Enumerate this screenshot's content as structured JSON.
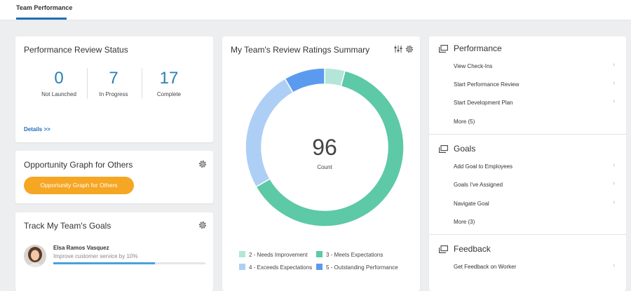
{
  "tab": {
    "label": "Team Performance"
  },
  "review_status": {
    "title": "Performance Review Status",
    "stats": [
      {
        "value": "0",
        "label": "Not Launched"
      },
      {
        "value": "7",
        "label": "In Progress"
      },
      {
        "value": "17",
        "label": "Complete"
      }
    ],
    "details_link": "Details >>"
  },
  "opportunity": {
    "title": "Opportunity Graph for Others",
    "button_label": "Opportunity Graph for Others"
  },
  "goals_card": {
    "title": "Track My Team's Goals",
    "goal": {
      "name": "Elsa Ramos Vasquez",
      "description": "Improve customer service by 10%",
      "progress": 0.67
    }
  },
  "ratings": {
    "title": "My Team's Review Ratings Summary",
    "total": "96",
    "total_label": "Count"
  },
  "chart_data": {
    "type": "pie",
    "subtype": "donut",
    "center_value": 96,
    "center_label": "Count",
    "series": [
      {
        "name": "2 - Needs Improvement",
        "value": 4,
        "color": "#b3e6d8"
      },
      {
        "name": "3 - Meets Expectations",
        "value": 60,
        "color": "#5dc9a6"
      },
      {
        "name": "4 - Exceeds Expectations",
        "value": 24,
        "color": "#aecff5"
      },
      {
        "name": "5 - Outstanding Performance",
        "value": 8,
        "color": "#5b9bef"
      }
    ]
  },
  "performance": {
    "title": "Performance",
    "items": [
      "View Check-Ins",
      "Start Performance Review",
      "Start Development Plan",
      "More (5)"
    ]
  },
  "goals": {
    "title": "Goals",
    "items": [
      "Add Goal to Employees",
      "Goals I've Assigned",
      "Navigate Goal",
      "More (3)"
    ]
  },
  "feedback": {
    "title": "Feedback",
    "items": [
      "Get Feedback on Worker"
    ]
  },
  "colors": {
    "accent": "#1f6fb8",
    "stat_number": "#2a7fb5",
    "button": "#f5a623"
  }
}
